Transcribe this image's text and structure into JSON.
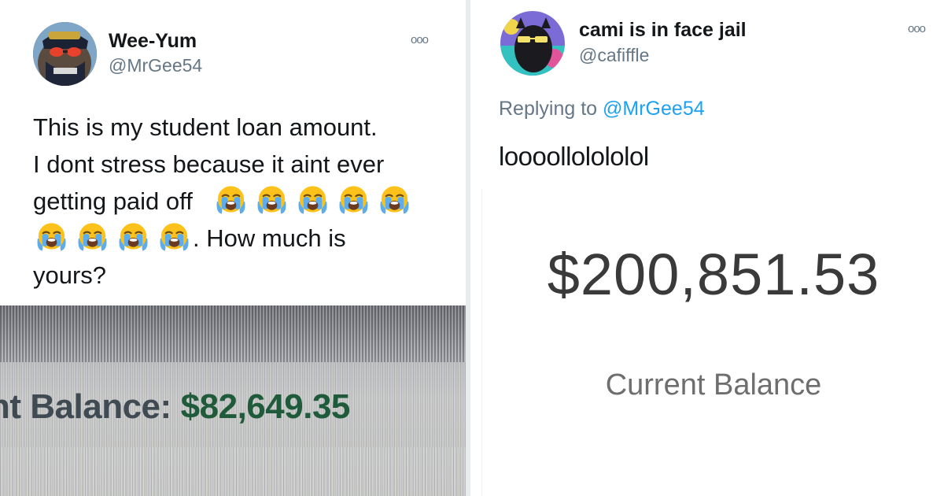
{
  "left_tweet": {
    "display_name": "Wee-Yum",
    "handle": "@MrGee54",
    "more_label": "ooo",
    "text_line1": "This is my student loan amount.",
    "text_line2": "I dont stress because it aint ever",
    "text_line3": "getting paid off",
    "text_line4_suffix": ". How much is",
    "text_line5": "yours?",
    "emoji_name": "loudly-crying-face",
    "emoji_count": 9,
    "photo": {
      "balance_label": "nt Balance:",
      "balance_value": "$82,649.35",
      "value_color": "#1f5a3a"
    }
  },
  "right_tweet": {
    "display_name": "cami is in face jail",
    "handle": "@cafiffle",
    "more_label": "ooo",
    "replying_prefix": "Replying to",
    "replying_mention": "@MrGee54",
    "text": "loooollоlоlоlоl",
    "photo": {
      "amount": "$200,851.53",
      "label": "Current Balance"
    }
  },
  "colors": {
    "link": "#1da1f2",
    "secondary_text": "#657786",
    "primary_text": "#14171a"
  }
}
